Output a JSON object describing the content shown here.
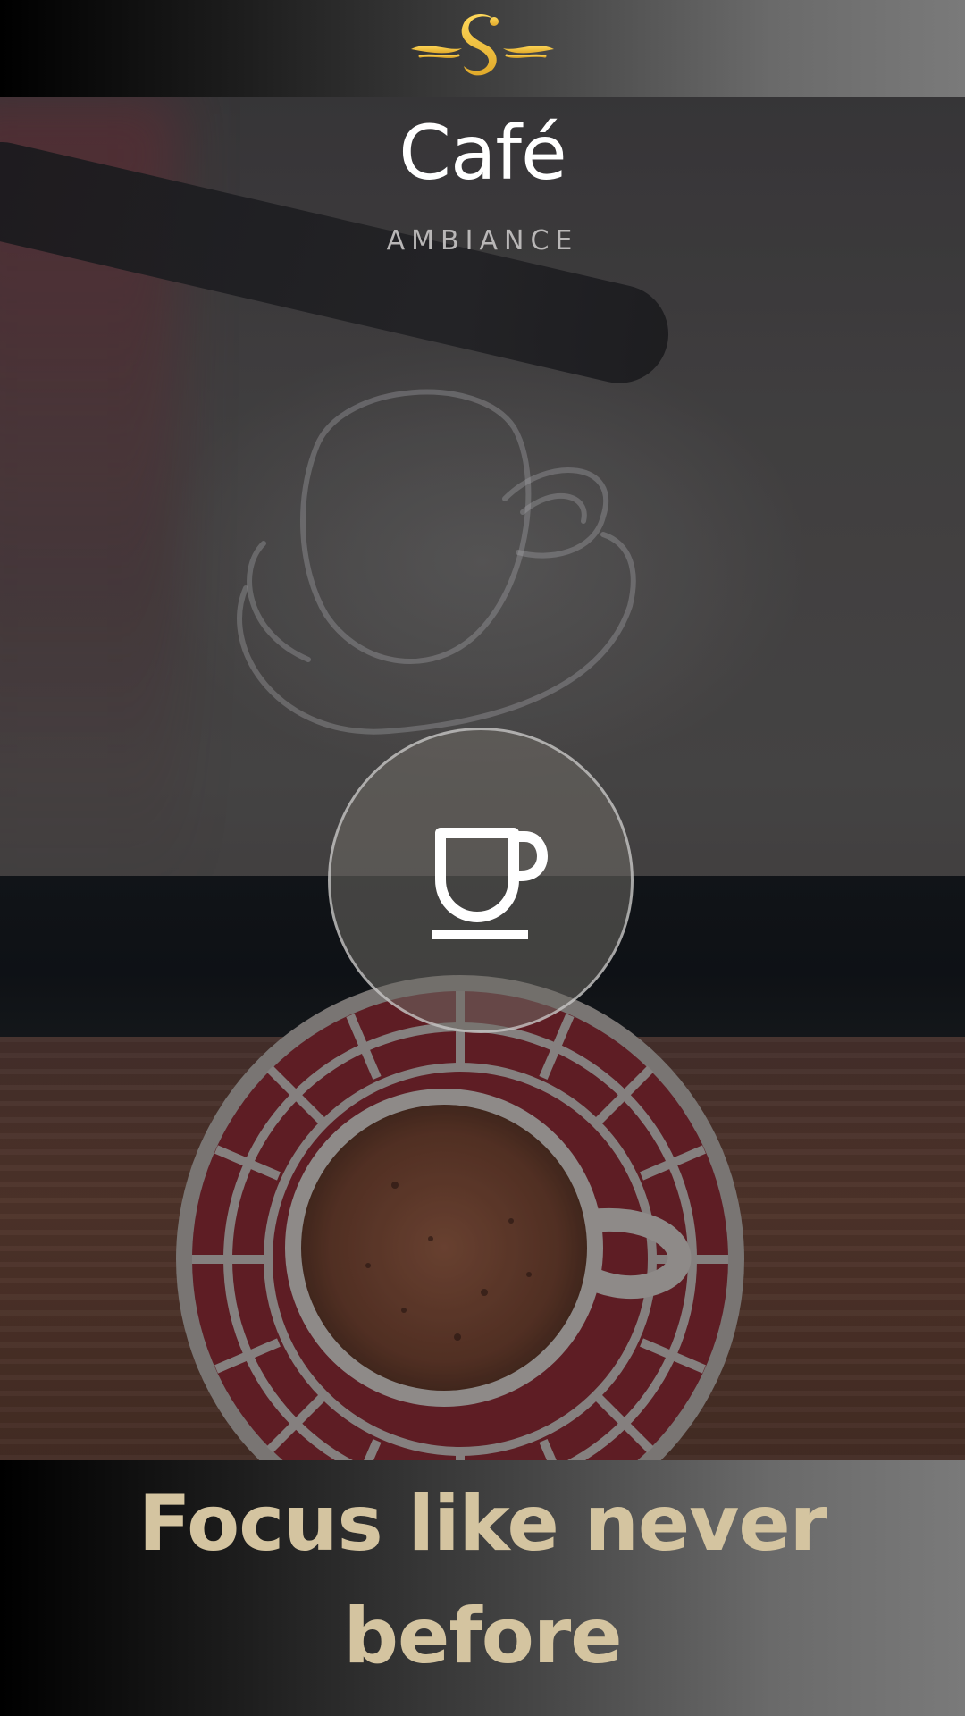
{
  "brand": {
    "logo_icon": "swan-s-logo-icon",
    "logo_color": "#f2c94c"
  },
  "header": {
    "title": "Café",
    "subtitle": "AMBIANCE"
  },
  "player": {
    "icon": "coffee-cup-icon"
  },
  "footer": {
    "tagline": "Focus like never before",
    "tagline_color": "#d4c4a0"
  }
}
